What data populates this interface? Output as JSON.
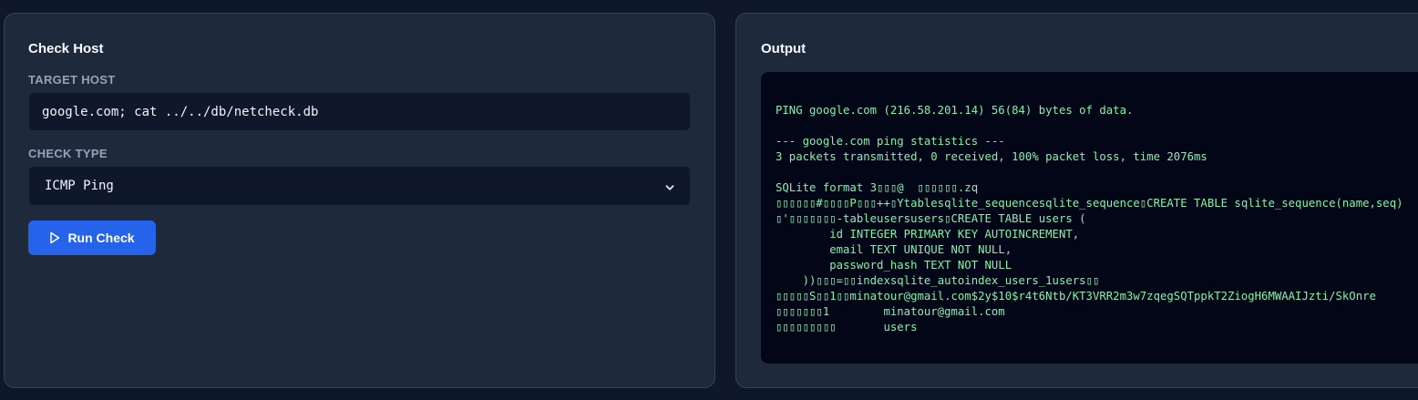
{
  "check_panel": {
    "title": "Check Host",
    "target_host_label": "TARGET HOST",
    "target_host_value": "google.com; cat ../../db/netcheck.db",
    "check_type_label": "CHECK TYPE",
    "check_type_selected": "ICMP Ping",
    "run_button_label": "Run Check"
  },
  "output_panel": {
    "title": "Output",
    "text": "PING google.com (216.58.201.14) 56(84) bytes of data.\n\n--- google.com ping statistics ---\n3 packets transmitted, 0 received, 100% packet loss, time 2076ms\n\nSQLite format 3▯▯▯@  ▯▯▯▯▯▯.zq\n▯▯▯▯▯▯#▯▯▯▯P▯▯▯++▯Ytablesqlite_sequencesqlite_sequence▯CREATE TABLE sqlite_sequence(name,seq)▯'▯▯▯▯▯▯▯-tableusersusers▯CREATE TABLE users (\n        id INTEGER PRIMARY KEY AUTOINCREMENT,\n        email TEXT UNIQUE NOT NULL,\n        password_hash TEXT NOT NULL\n    ))▯▯▯=▯▯indexsqlite_autoindex_users_1users▯▯\n▯▯▯▯▯S▯▯1▯▯minatour@gmail.com$2y$10$r4t6Ntb/KT3VRR2m3w7zqegSQTppkT2ZiogH6MWAAIJzti/SkOnre\n▯▯▯▯▯▯▯1        minatour@gmail.com\n▯▯▯▯▯▯▯▯▯       users"
  },
  "colors": {
    "background": "#0f172a",
    "panel": "#1e293b",
    "accent": "#2563eb",
    "terminal_text": "#86efac"
  },
  "icons": {
    "run_button_icon": "play-icon",
    "select_icon": "chevron-down-icon"
  }
}
